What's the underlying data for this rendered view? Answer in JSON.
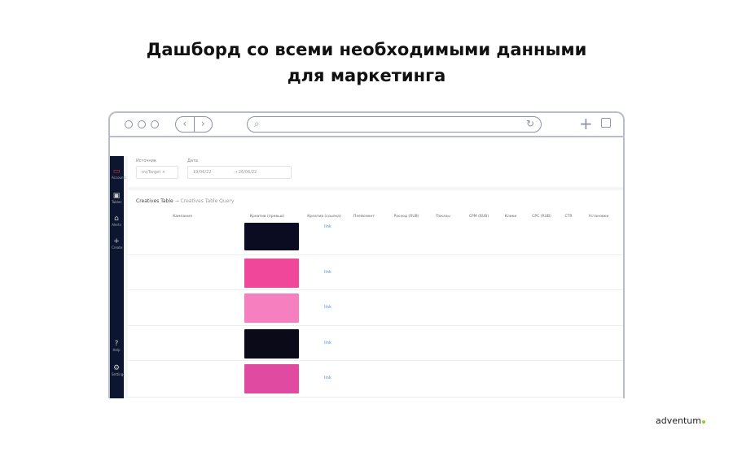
{
  "heading": {
    "line1": "Дашборд со всеми необходимыми данными",
    "line2": "для маркетинга"
  },
  "browser": {
    "back": "‹",
    "forward": "›",
    "search_icon": "⌕",
    "reload_icon": "↻",
    "new_tab": "+"
  },
  "sidebar": {
    "items": [
      {
        "icon": "accounts-icon",
        "label": "Accounts"
      },
      {
        "icon": "tables-icon",
        "label": "Tables"
      },
      {
        "icon": "alerts-icon",
        "label": "Alerts"
      },
      {
        "icon": "create-icon",
        "label": "Create"
      },
      {
        "icon": "help-icon",
        "label": "Help"
      },
      {
        "icon": "settings-icon",
        "label": "Settings"
      }
    ]
  },
  "filters": {
    "source_label": "Источник",
    "source_value": "myTarget ×",
    "date_label": "Дата",
    "date_from": "19/06/22",
    "date_sep": "→",
    "date_to": "26/06/22"
  },
  "table": {
    "title": "Creatives Table",
    "subtitle": "→ Creatives Table Query",
    "columns": [
      "Кампания",
      "Креатив (превью)",
      "Креатив (ссылка)",
      "Плейсмент",
      "Расход (RUB)",
      "Показы",
      "CPM (RUB)",
      "Клики",
      "CPC (RUB)",
      "CTR",
      "Установки"
    ],
    "rows": [
      {
        "link": "link",
        "thumb_color": "#0b0b22"
      },
      {
        "link": "link",
        "thumb_color": "#f0479a"
      },
      {
        "link": "link",
        "thumb_color": "#f57fbf"
      },
      {
        "link": "link",
        "thumb_color": "#0a0a18"
      },
      {
        "link": "link",
        "thumb_color": "#e04aa0"
      }
    ]
  },
  "brand": {
    "name": "adventum",
    "dot_color": "#8bd12a"
  }
}
